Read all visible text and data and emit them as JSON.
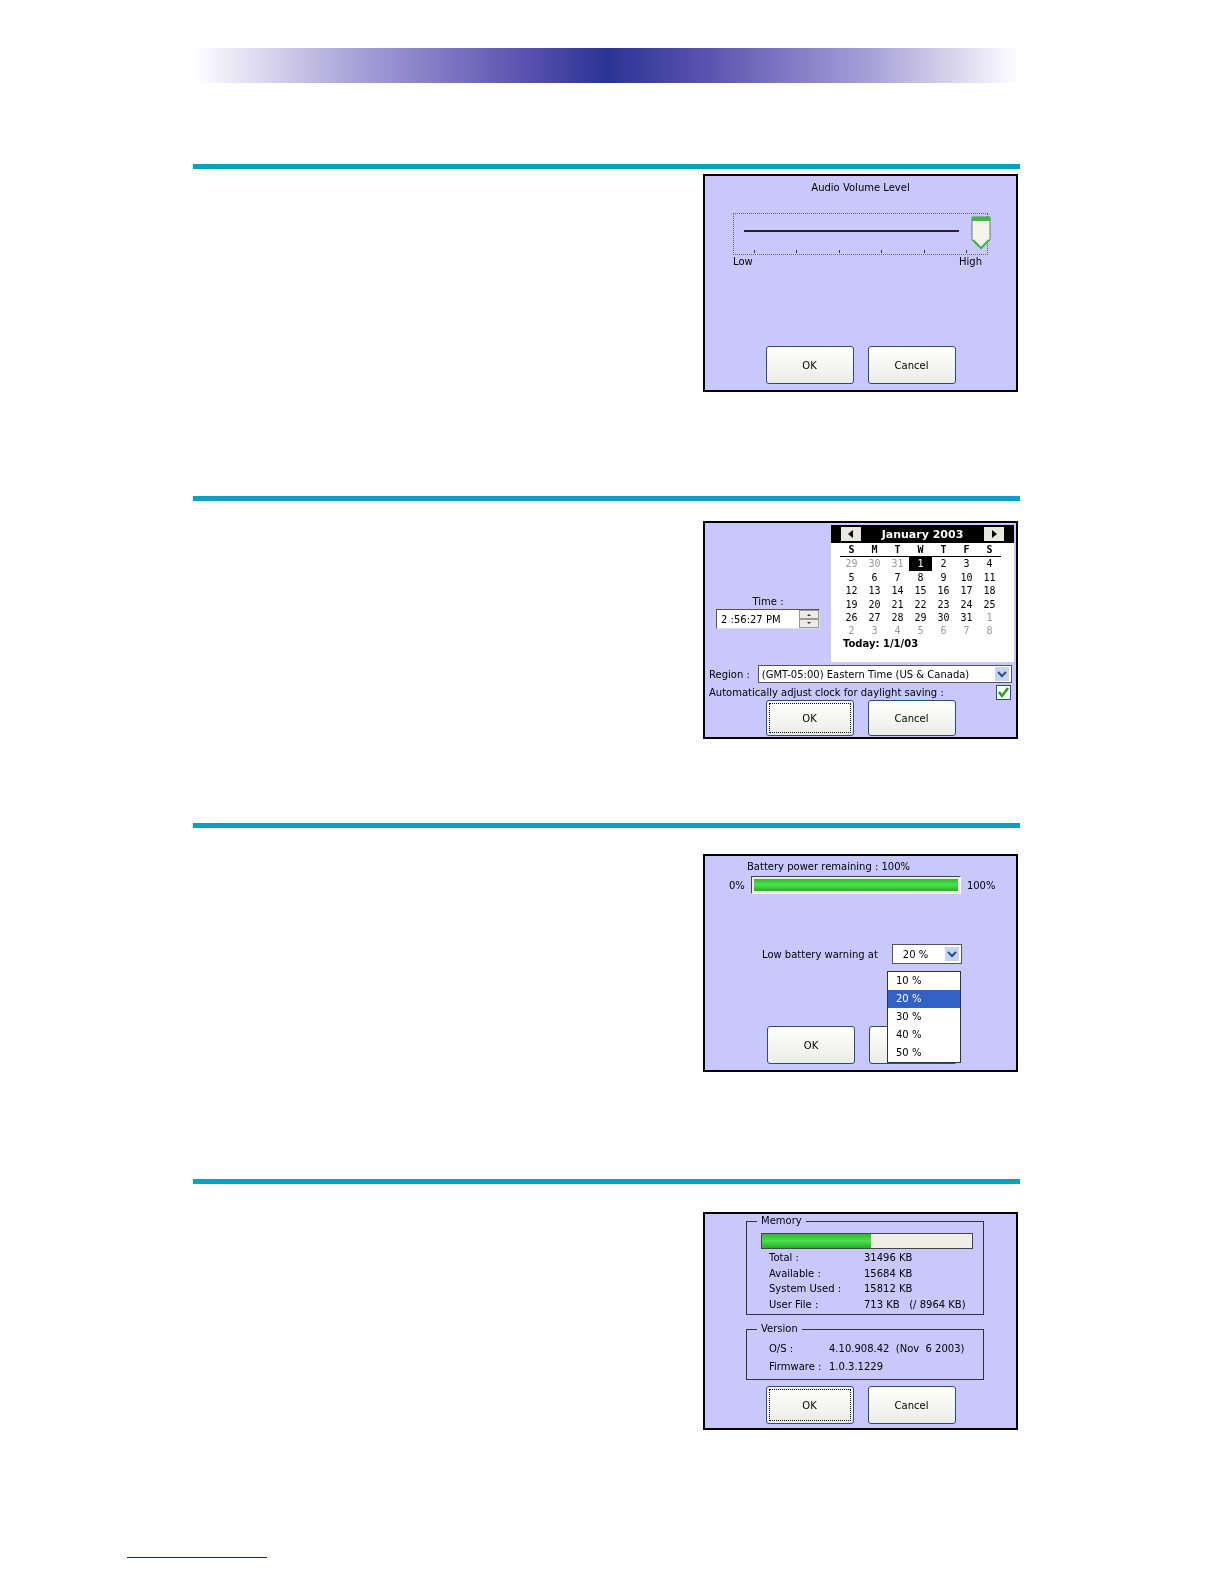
{
  "volume": {
    "title": "Audio Volume Level",
    "slider": {
      "level": 1.0
    },
    "low_label": "Low",
    "high_label": "High",
    "buttons": [
      {
        "label": "OK",
        "focused": false
      },
      {
        "label": "Cancel",
        "focused": false
      }
    ]
  },
  "datetime": {
    "time_label": "Time :",
    "time_value": "2 :56:27 PM",
    "month": "January 2003",
    "weekdays": [
      "S",
      "M",
      "T",
      "W",
      "T",
      "F",
      "S"
    ],
    "days": [
      {
        "label": "29",
        "kind": "other",
        "selected": false
      },
      {
        "label": "30",
        "kind": "other",
        "selected": false
      },
      {
        "label": "31",
        "kind": "other",
        "selected": false
      },
      {
        "label": "1",
        "kind": "current",
        "selected": true
      },
      {
        "label": "2",
        "kind": "current",
        "selected": false
      },
      {
        "label": "3",
        "kind": "current",
        "selected": false
      },
      {
        "label": "4",
        "kind": "current",
        "selected": false
      },
      {
        "label": "5",
        "kind": "current",
        "selected": false
      },
      {
        "label": "6",
        "kind": "current",
        "selected": false
      },
      {
        "label": "7",
        "kind": "current",
        "selected": false
      },
      {
        "label": "8",
        "kind": "current",
        "selected": false
      },
      {
        "label": "9",
        "kind": "current",
        "selected": false
      },
      {
        "label": "10",
        "kind": "current",
        "selected": false
      },
      {
        "label": "11",
        "kind": "current",
        "selected": false
      },
      {
        "label": "12",
        "kind": "current",
        "selected": false
      },
      {
        "label": "13",
        "kind": "current",
        "selected": false
      },
      {
        "label": "14",
        "kind": "current",
        "selected": false
      },
      {
        "label": "15",
        "kind": "current",
        "selected": false
      },
      {
        "label": "16",
        "kind": "current",
        "selected": false
      },
      {
        "label": "17",
        "kind": "current",
        "selected": false
      },
      {
        "label": "18",
        "kind": "current",
        "selected": false
      },
      {
        "label": "19",
        "kind": "current",
        "selected": false
      },
      {
        "label": "20",
        "kind": "current",
        "selected": false
      },
      {
        "label": "21",
        "kind": "current",
        "selected": false
      },
      {
        "label": "22",
        "kind": "current",
        "selected": false
      },
      {
        "label": "23",
        "kind": "current",
        "selected": false
      },
      {
        "label": "24",
        "kind": "current",
        "selected": false
      },
      {
        "label": "25",
        "kind": "current",
        "selected": false
      },
      {
        "label": "26",
        "kind": "current",
        "selected": false
      },
      {
        "label": "27",
        "kind": "current",
        "selected": false
      },
      {
        "label": "28",
        "kind": "current",
        "selected": false
      },
      {
        "label": "29",
        "kind": "current",
        "selected": false
      },
      {
        "label": "30",
        "kind": "current",
        "selected": false
      },
      {
        "label": "31",
        "kind": "current",
        "selected": false
      },
      {
        "label": "1",
        "kind": "other",
        "selected": false
      },
      {
        "label": "2",
        "kind": "other",
        "selected": false
      },
      {
        "label": "3",
        "kind": "other",
        "selected": false
      },
      {
        "label": "4",
        "kind": "other",
        "selected": false
      },
      {
        "label": "5",
        "kind": "other",
        "selected": false
      },
      {
        "label": "6",
        "kind": "other",
        "selected": false
      },
      {
        "label": "7",
        "kind": "other",
        "selected": false
      },
      {
        "label": "8",
        "kind": "other",
        "selected": false
      }
    ],
    "today": "Today: 1/1/03",
    "region_label": "Region :",
    "region_value": "(GMT-05:00) Eastern Time (US & Canada)",
    "dst_label": "Automatically adjust clock for daylight saving :",
    "dst_checked": true,
    "buttons": [
      {
        "label": "OK",
        "focused": true
      },
      {
        "label": "Cancel",
        "focused": false
      }
    ]
  },
  "battery": {
    "remaining_label": "Battery power remaining :  100%",
    "min_label": "0%",
    "max_label": "100%",
    "meter": {
      "level": 1.0
    },
    "warning_label": "Low battery warning at",
    "warning_value": "20 %",
    "options": [
      {
        "label": "10 %",
        "selected": false
      },
      {
        "label": "20 %",
        "selected": true
      },
      {
        "label": "30 %",
        "selected": false
      },
      {
        "label": "40 %",
        "selected": false
      },
      {
        "label": "50 %",
        "selected": false
      }
    ],
    "ok_button": {
      "label": "OK",
      "focused": false
    }
  },
  "system": {
    "memory_title": "Memory",
    "memory_bar": {
      "level": 0.52
    },
    "memory_rows": [
      {
        "label": "Total :",
        "value": "31496 KB"
      },
      {
        "label": "Available :",
        "value": "15684 KB"
      },
      {
        "label": "System Used :",
        "value": "15812 KB"
      },
      {
        "label": "User File :",
        "value": "713 KB   (/ 8964 KB)"
      }
    ],
    "version_title": "Version",
    "version_rows": [
      {
        "label": "O/S :",
        "value": "4.10.908.42  (Nov  6 2003)"
      },
      {
        "label": "Firmware :",
        "value": "1.0.3.1229"
      }
    ],
    "buttons": [
      {
        "label": "OK",
        "focused": true
      },
      {
        "label": "Cancel",
        "focused": false
      }
    ]
  }
}
